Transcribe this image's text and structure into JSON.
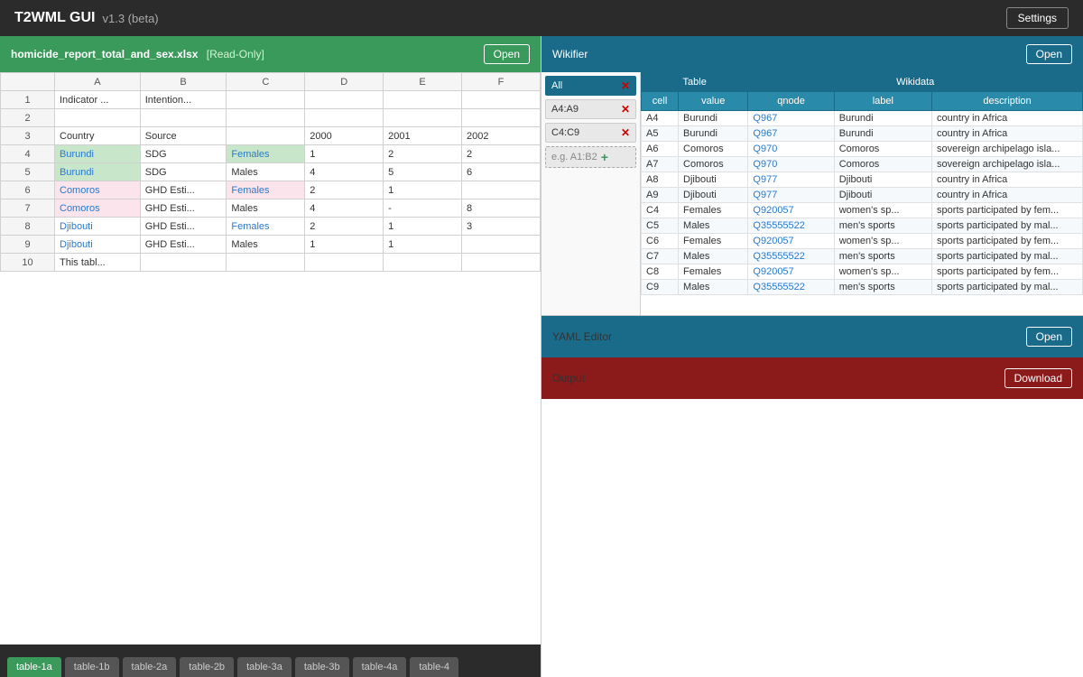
{
  "topbar": {
    "title": "T2WML GUI",
    "version": "v1.3 (beta)",
    "settings_label": "Settings"
  },
  "left_panel": {
    "file_name": "homicide_report_total_and_sex.xlsx",
    "readonly": "[Read-Only]",
    "open_label": "Open",
    "sheet": {
      "col_headers": [
        "",
        "A",
        "B",
        "C",
        "D",
        "E",
        "F"
      ],
      "rows": [
        {
          "num": "1",
          "cells": [
            "Indicator ...",
            "Intention...",
            "",
            "",
            "",
            ""
          ]
        },
        {
          "num": "2",
          "cells": [
            "",
            "",
            "",
            "",
            "",
            ""
          ]
        },
        {
          "num": "3",
          "cells": [
            "Country",
            "Source",
            "",
            "2000",
            "2001",
            "2002"
          ]
        },
        {
          "num": "4",
          "cells": [
            "Burundi",
            "SDG",
            "Females",
            "1",
            "2",
            "2"
          ],
          "style": [
            "green",
            "",
            "green",
            "",
            "",
            ""
          ]
        },
        {
          "num": "5",
          "cells": [
            "Burundi",
            "SDG",
            "Males",
            "4",
            "5",
            "6"
          ],
          "style": [
            "green",
            "",
            "",
            "",
            "",
            ""
          ]
        },
        {
          "num": "6",
          "cells": [
            "Comoros",
            "GHD Esti...",
            "Females",
            "2",
            "1",
            ""
          ],
          "style": [
            "pink",
            "",
            "pink",
            "",
            "",
            ""
          ]
        },
        {
          "num": "7",
          "cells": [
            "Comoros",
            "GHD Esti...",
            "Males",
            "4",
            "-",
            "8"
          ],
          "style": [
            "pink",
            "",
            "",
            "",
            "",
            ""
          ]
        },
        {
          "num": "8",
          "cells": [
            "Djibouti",
            "GHD Esti...",
            "Females",
            "2",
            "1",
            "3"
          ],
          "style": [
            "link",
            "",
            "link",
            "",
            "",
            ""
          ]
        },
        {
          "num": "9",
          "cells": [
            "Djibouti",
            "GHD Esti...",
            "Males",
            "1",
            "1",
            ""
          ],
          "style": [
            "link",
            "",
            "",
            "",
            "",
            ""
          ]
        },
        {
          "num": "10",
          "cells": [
            "This tabl...",
            "",
            "",
            "",
            "",
            ""
          ]
        }
      ]
    },
    "tabs": [
      "table-1a",
      "table-1b",
      "table-2a",
      "table-2b",
      "table-3a",
      "table-3b",
      "table-4a",
      "table-4"
    ]
  },
  "wikifier": {
    "title": "Wikifier",
    "open_label": "Open",
    "filters": [
      {
        "id": "all",
        "label": "All",
        "active": true
      },
      {
        "id": "A4:A9",
        "label": "A4:A9",
        "active": false
      },
      {
        "id": "C4:C9",
        "label": "C4:C9",
        "active": false
      }
    ],
    "add_placeholder": "e.g. A1:B2",
    "table_headers": {
      "table": "Table",
      "wikidata": "Wikidata",
      "cell": "cell",
      "value": "value",
      "qnode": "qnode",
      "label": "label",
      "description": "description"
    },
    "rows": [
      {
        "cell": "A4",
        "value": "Burundi",
        "qnode": "Q967",
        "label": "Burundi",
        "description": "country in Africa"
      },
      {
        "cell": "A5",
        "value": "Burundi",
        "qnode": "Q967",
        "label": "Burundi",
        "description": "country in Africa"
      },
      {
        "cell": "A6",
        "value": "Comoros",
        "qnode": "Q970",
        "label": "Comoros",
        "description": "sovereign archipelago isla..."
      },
      {
        "cell": "A7",
        "value": "Comoros",
        "qnode": "Q970",
        "label": "Comoros",
        "description": "sovereign archipelago isla..."
      },
      {
        "cell": "A8",
        "value": "Djibouti",
        "qnode": "Q977",
        "label": "Djibouti",
        "description": "country in Africa"
      },
      {
        "cell": "A9",
        "value": "Djibouti",
        "qnode": "Q977",
        "label": "Djibouti",
        "description": "country in Africa"
      },
      {
        "cell": "C4",
        "value": "Females",
        "qnode": "Q920057",
        "label": "women's sp...",
        "description": "sports participated by fem..."
      },
      {
        "cell": "C5",
        "value": "Males",
        "qnode": "Q35555522",
        "label": "men's sports",
        "description": "sports participated by mal..."
      },
      {
        "cell": "C6",
        "value": "Females",
        "qnode": "Q920057",
        "label": "women's sp...",
        "description": "sports participated by fem..."
      },
      {
        "cell": "C7",
        "value": "Males",
        "qnode": "Q35555522",
        "label": "men's sports",
        "description": "sports participated by mal..."
      },
      {
        "cell": "C8",
        "value": "Females",
        "qnode": "Q920057",
        "label": "women's sp...",
        "description": "sports participated by fem..."
      },
      {
        "cell": "C9",
        "value": "Males",
        "qnode": "Q35555522",
        "label": "men's sports",
        "description": "sports participated by mal..."
      }
    ]
  },
  "yaml_editor": {
    "title": "YAML Editor",
    "open_label": "Open"
  },
  "output": {
    "title": "Output",
    "download_label": "Download"
  }
}
